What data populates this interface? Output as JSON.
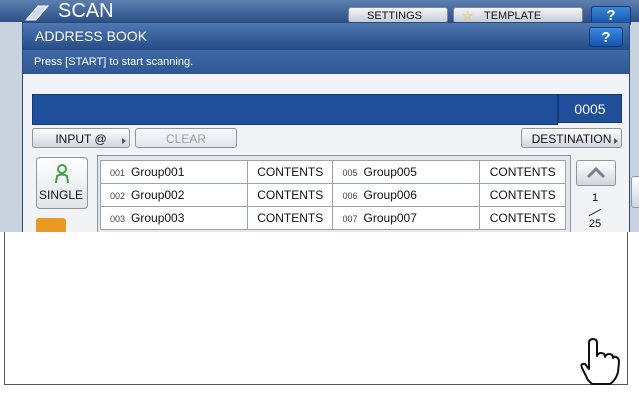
{
  "top": {
    "title": "SCAN",
    "settings_label": "SETTINGS",
    "template_label": "TEMPLATE",
    "help_label": "?"
  },
  "dialog": {
    "title": "ADDRESS BOOK",
    "help_label": "?",
    "message": "Press [START] to start scanning.",
    "input_value": "",
    "count": "0005",
    "buttons": {
      "input_at": "INPUT @",
      "clear": "CLEAR",
      "destination": "DESTINATION"
    },
    "tabs": {
      "single": "SINGLE",
      "group": ""
    },
    "rows": [
      {
        "left_num": "001",
        "left_name": "Group001",
        "left_contents": "CONTENTS",
        "right_num": "005",
        "right_name": "Group005",
        "right_contents": "CONTENTS"
      },
      {
        "left_num": "002",
        "left_name": "Group002",
        "left_contents": "CONTENTS",
        "right_num": "006",
        "right_name": "Group006",
        "right_contents": "CONTENTS"
      },
      {
        "left_num": "003",
        "left_name": "Group003",
        "left_contents": "CONTENTS",
        "right_num": "007",
        "right_name": "Group007",
        "right_contents": "CONTENTS"
      }
    ],
    "pager": {
      "current": "1",
      "total": "25"
    }
  },
  "colors": {
    "title_bar": "#2c4f86",
    "input_bar": "#1f4f9a",
    "group_tab": "#e99a22",
    "single_icon": "#43a047"
  },
  "icons": {
    "scan": "scan-icon",
    "template": "star-icon",
    "single_tab": "person-icon",
    "scroll_up": "chevron-up-icon",
    "cursor": "hand-pointer-icon"
  }
}
